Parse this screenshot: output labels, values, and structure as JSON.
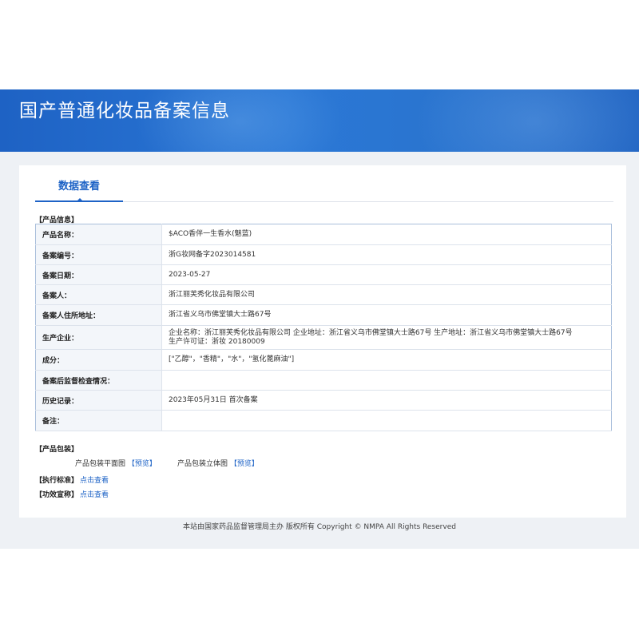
{
  "header": {
    "title": "国产普通化妆品备案信息"
  },
  "tabs": [
    {
      "label": "数据查看"
    }
  ],
  "product_info": {
    "section_label": "【产品信息】",
    "rows": [
      {
        "label": "产品名称：",
        "value": "$ACO香伴一生香水(魅蓝)"
      },
      {
        "label": "备案编号：",
        "value": "浙G妆网备字2023014581"
      },
      {
        "label": "备案日期：",
        "value": "2023-05-27"
      },
      {
        "label": "备案人：",
        "value": "浙江丽芙秀化妆品有限公司"
      },
      {
        "label": "备案人住所地址：",
        "value": "浙江省义乌市佛堂镇大士路67号"
      },
      {
        "label": "生产企业：",
        "value": "企业名称：浙江丽芙秀化妆品有限公司 企业地址：浙江省义乌市佛堂镇大士路67号 生产地址：浙江省义乌市佛堂镇大士路67号 生产许可证：浙妆 20180009"
      },
      {
        "label": "成分：",
        "value": "[\"乙醇\"，\"香精\"，\"水\"，\"氢化蓖麻油\"]"
      },
      {
        "label": "备案后监督检查情况：",
        "value": ""
      },
      {
        "label": "历史记录：",
        "value": "2023年05月31日 首次备案"
      },
      {
        "label": "备注：",
        "value": ""
      }
    ]
  },
  "packaging": {
    "section_label": "【产品包装】",
    "flat_label": "产品包装平面图",
    "flat_link": "【预览】",
    "solid_label": "产品包装立体图",
    "solid_link": "【预览】"
  },
  "standard": {
    "label": "【执行标准】",
    "link": "点击查看"
  },
  "efficacy": {
    "label": "【功效宣称】",
    "link": "点击查看"
  },
  "footer": {
    "text": "本站由国家药品监督管理局主办 版权所有 Copyright © NMPA All Rights Reserved"
  },
  "colors": {
    "accent": "#1e63c6",
    "banner": "#2b78d6",
    "background": "#eef1f5"
  }
}
